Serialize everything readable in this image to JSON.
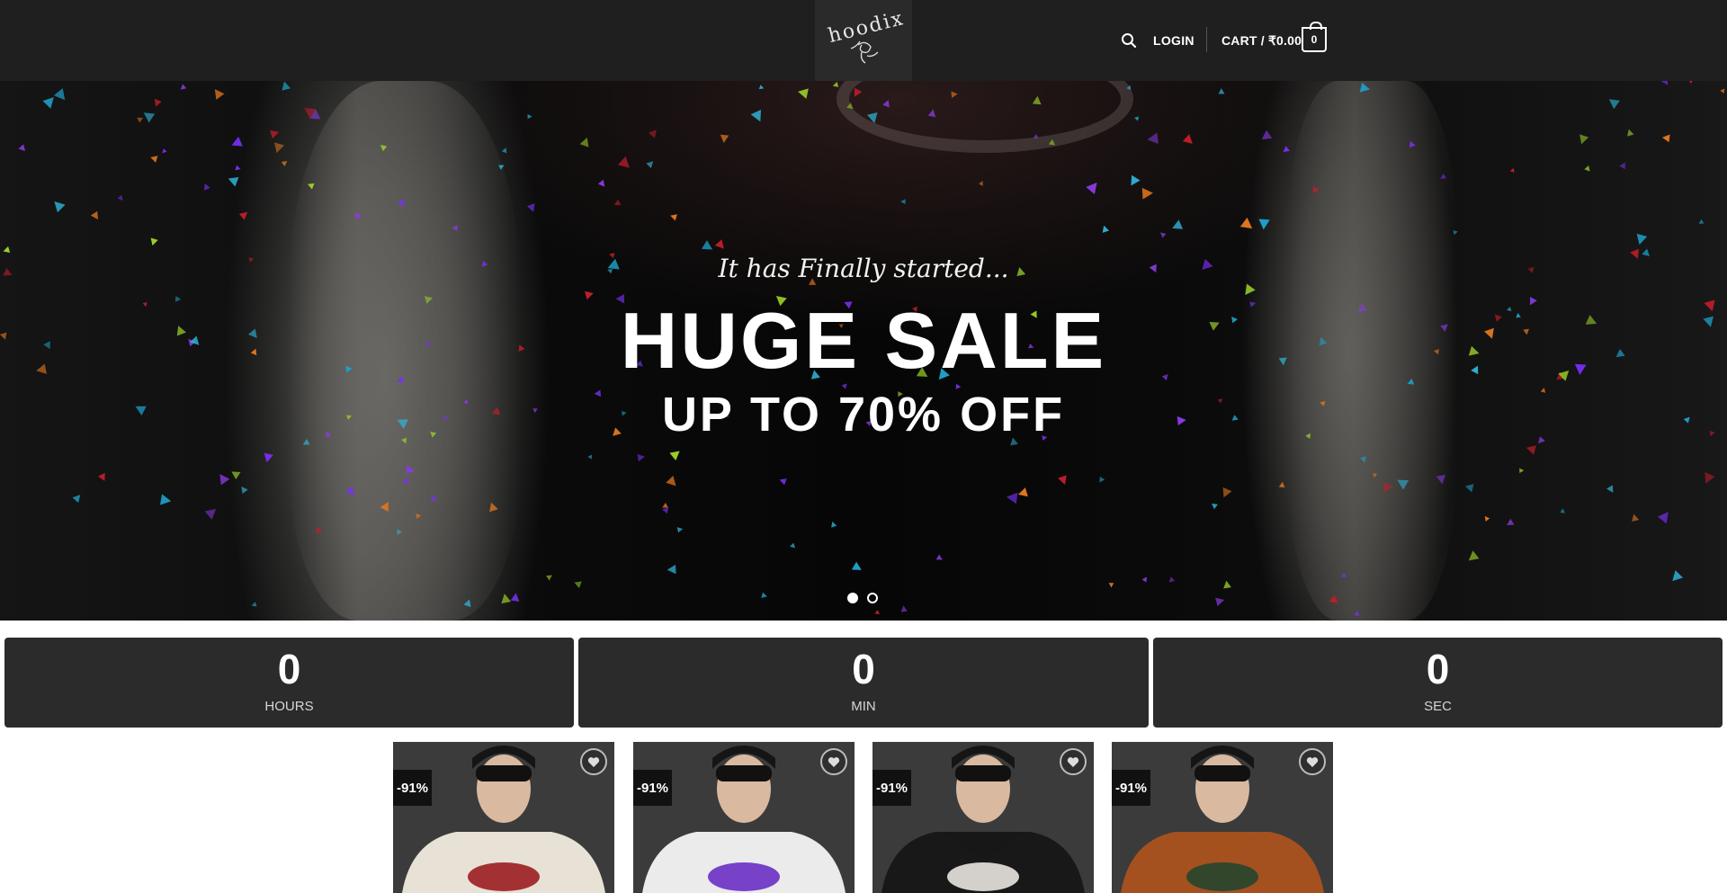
{
  "header": {
    "logo_text": "hoodix",
    "login_label": "LOGIN",
    "cart_label": "CART / ₹0.00",
    "cart_count": "0",
    "search_icon": "search-icon"
  },
  "hero": {
    "tagline": "It has Finally started...",
    "title": "HUGE SALE",
    "subtitle": "UP TO 70% OFF",
    "slides": 2,
    "active_slide": 1
  },
  "countdown": [
    {
      "value": "0",
      "label": "HOURS"
    },
    {
      "value": "0",
      "label": "MIN"
    },
    {
      "value": "0",
      "label": "SEC"
    }
  ],
  "products": [
    {
      "badge": "-91%",
      "hoodie_color": "#e8e2d6",
      "print_color": "#9b1e22",
      "wishlist_icon": "heart-icon"
    },
    {
      "badge": "-91%",
      "hoodie_color": "#ecebec",
      "print_color": "#6a2fc4",
      "wishlist_icon": "heart-icon"
    },
    {
      "badge": "-91%",
      "hoodie_color": "#181818",
      "print_color": "#e9e6e0",
      "wishlist_icon": "heart-icon"
    },
    {
      "badge": "-91%",
      "hoodie_color": "#a4511f",
      "print_color": "#26452e",
      "wishlist_icon": "heart-icon"
    }
  ],
  "colors": {
    "header_bg": "#1f1f1f",
    "countdown_bg": "#2b2b2b",
    "badge_bg": "#111111"
  }
}
